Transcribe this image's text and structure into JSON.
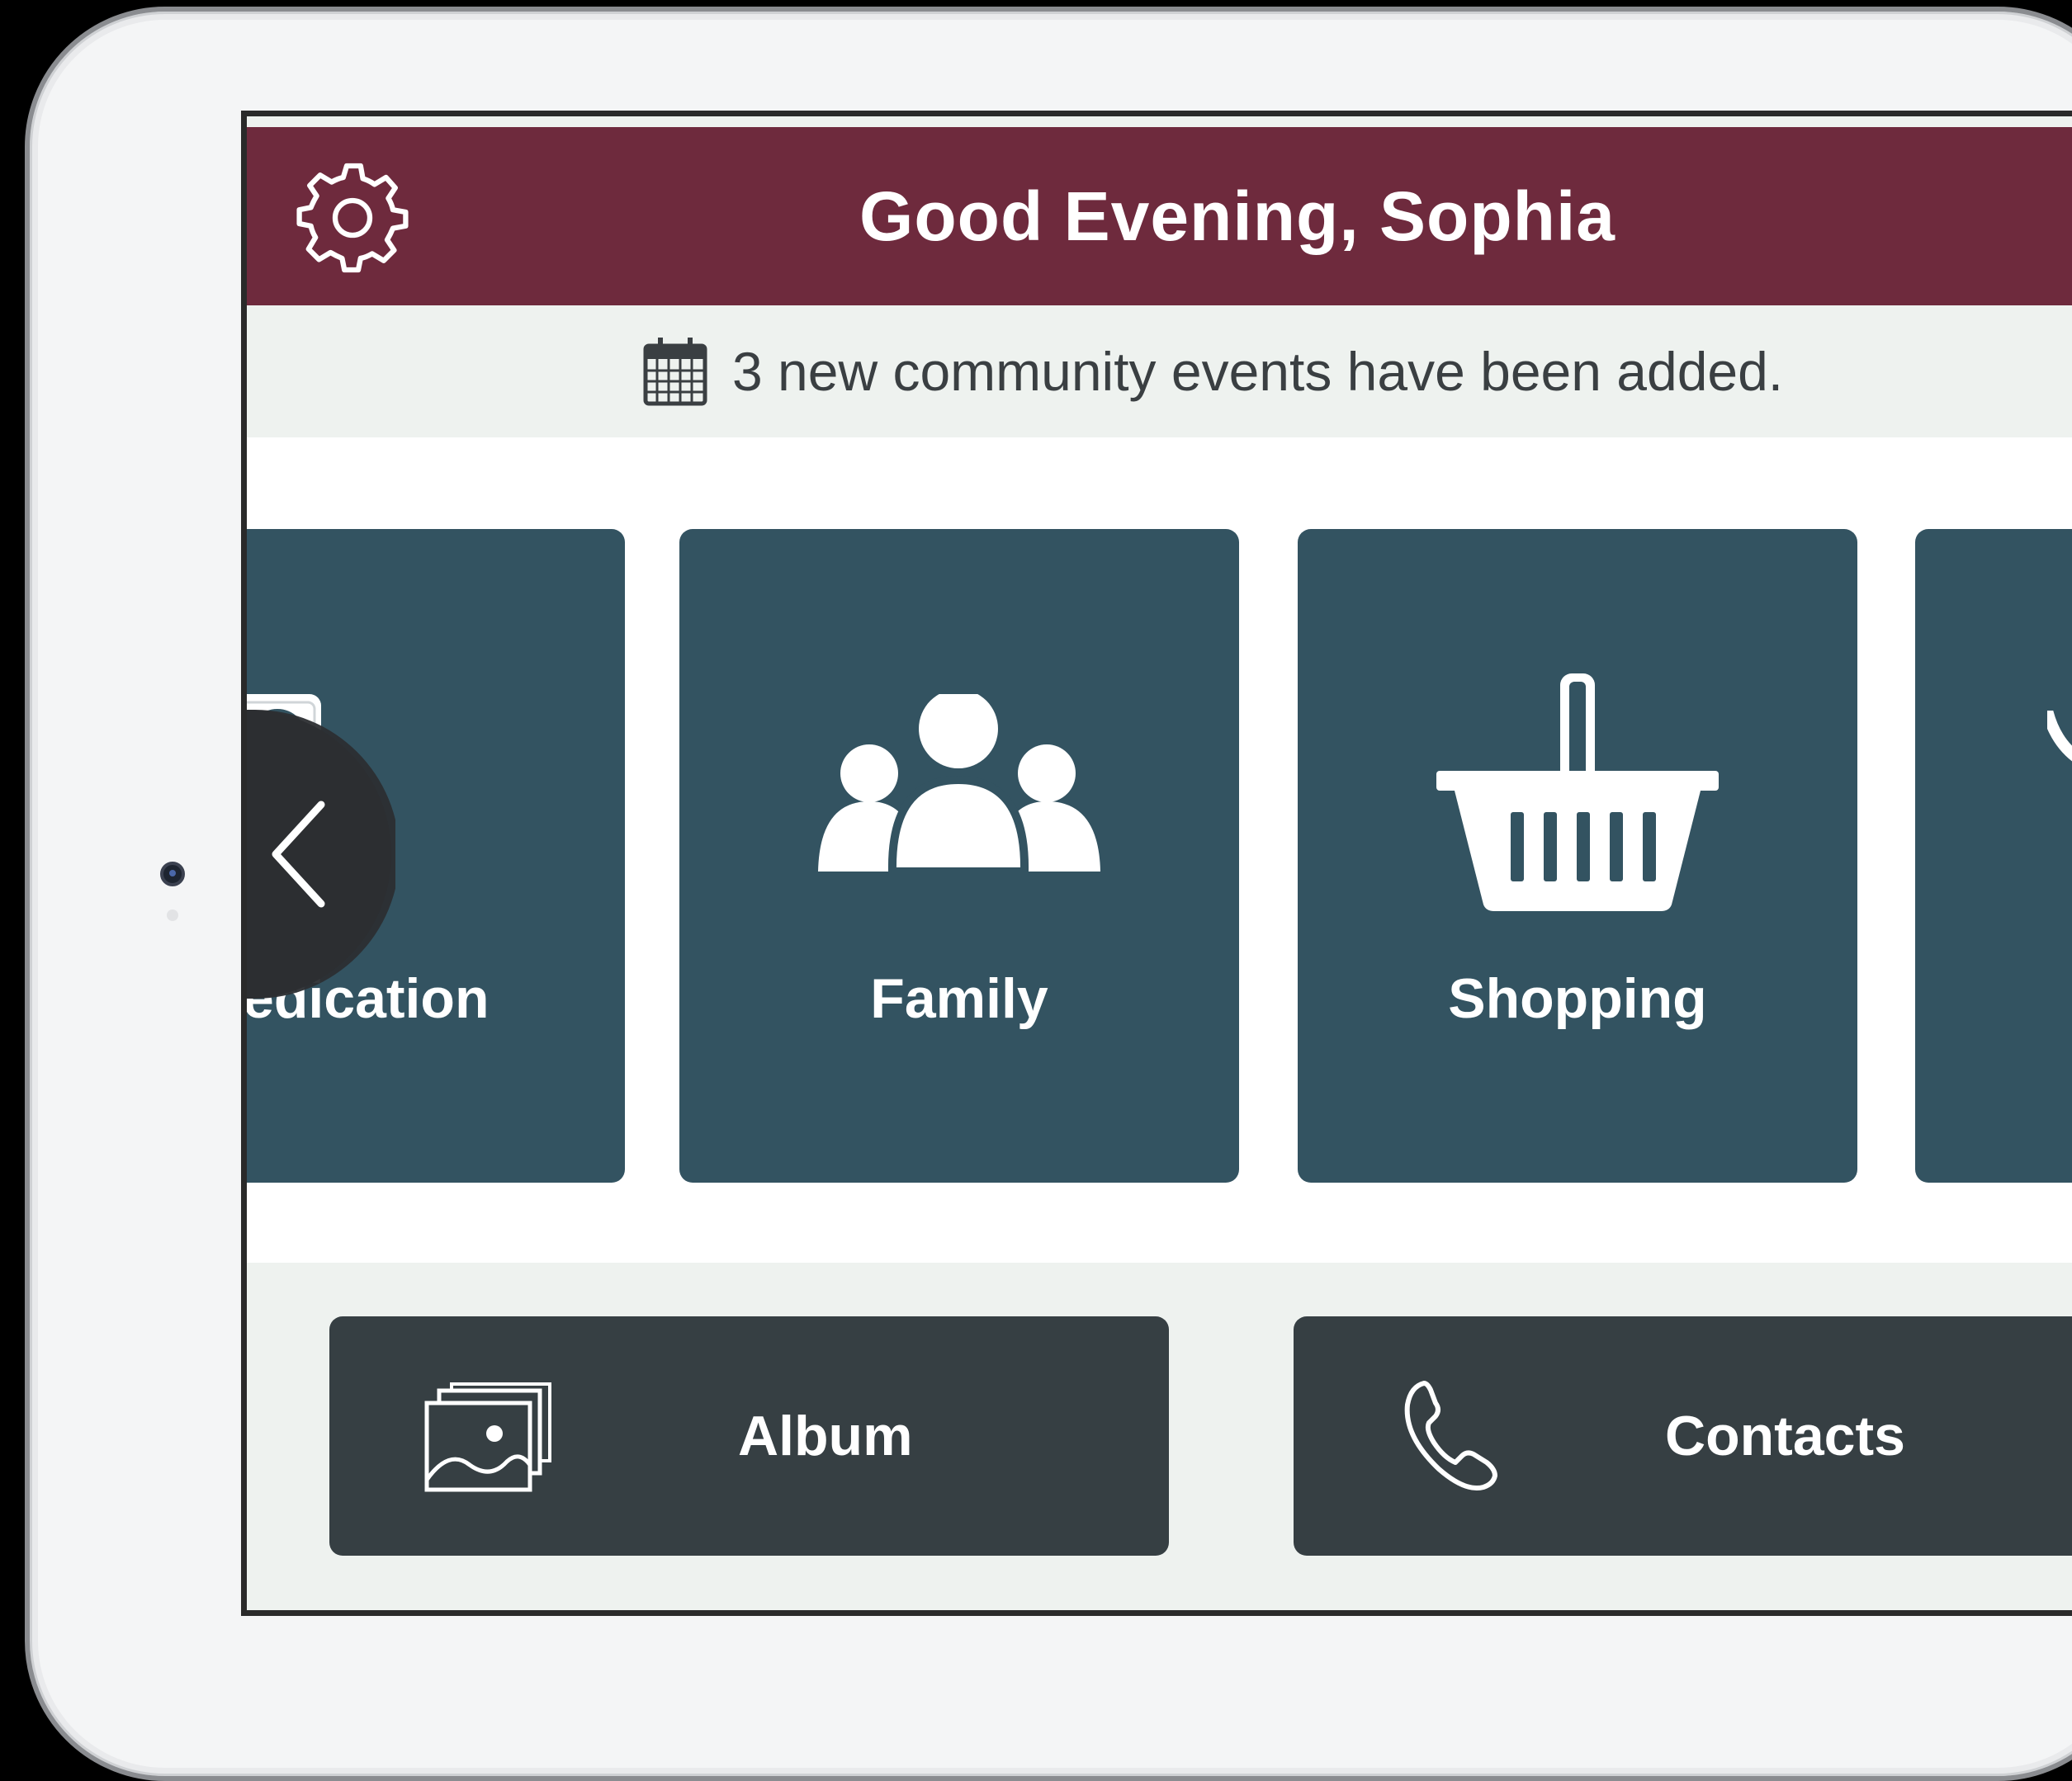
{
  "header": {
    "greeting": "Good Evening, Sophia",
    "background_color": "#6e2a3d",
    "settings_icon": "gear-icon"
  },
  "notice": {
    "icon": "calendar-icon",
    "text": "3 new community events have been added."
  },
  "tiles": [
    {
      "label": "edication",
      "icon": "pill-case-icon"
    },
    {
      "label": "Family",
      "icon": "family-icon"
    },
    {
      "label": "Shopping",
      "icon": "shopping-basket-icon"
    },
    {
      "label": "",
      "icon": "partial-tile"
    }
  ],
  "tile_color": "#335361",
  "carousel": {
    "prev_icon": "chevron-left-icon"
  },
  "actions": [
    {
      "label": "Album",
      "icon": "photo-album-icon"
    },
    {
      "label": "Contacts",
      "icon": "phone-icon"
    }
  ],
  "action_color": "#363f43"
}
